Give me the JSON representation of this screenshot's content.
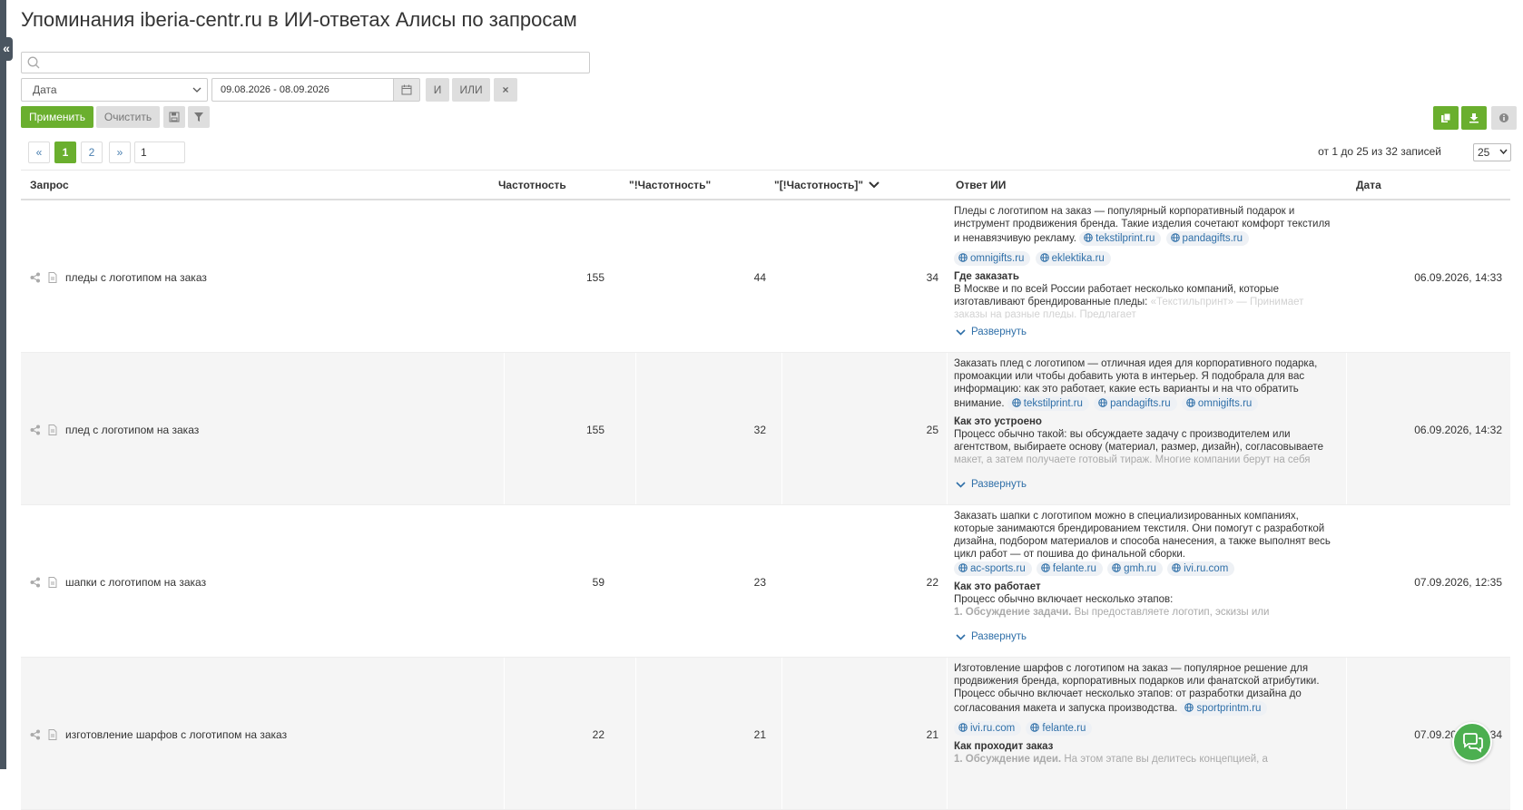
{
  "page": {
    "title": "Упоминания iberia-centr.ru в ИИ-ответах Алисы по запросам"
  },
  "search": {
    "value": "",
    "placeholder": ""
  },
  "filters": {
    "field_label": "Дата",
    "date_range": "09.08.2026 - 08.09.2026",
    "and_label": "И",
    "or_label": "ИЛИ",
    "remove_label": "×"
  },
  "actions": {
    "apply_label": "Применить",
    "clear_label": "Очистить"
  },
  "pagination": {
    "prev_label": "«",
    "pages": [
      "1",
      "2"
    ],
    "next_label": "»",
    "jump_value": "1",
    "records_info": "от 1 до 25 из 32 записей",
    "per_page": "25"
  },
  "table": {
    "columns": [
      "Запрос",
      "Частотность",
      "\"!Частотность\"",
      "\"[!Частотность]\"",
      "Ответ ИИ",
      "Дата"
    ],
    "sorted_column_index": 3,
    "expand_label": "Развернуть",
    "rows": [
      {
        "query": "пледы с логотипом на заказ",
        "freq": "155",
        "freq_exact": "44",
        "freq_exact_order": "34",
        "date": "06.09.2026, 14:33",
        "answer": {
          "intro": "Пледы с логотипом на заказ — популярный корпоративный подарок и инструмент продвижения бренда. Такие изделия сочетают комфорт текстиля и ненавязчивую рекламу.",
          "sources_inline": [
            "tekstilprint.ru",
            "pandagifts.ru"
          ],
          "sources_row": [
            "omnigifts.ru",
            "eklektika.ru"
          ],
          "heading": "Где заказать",
          "body": "В Москве и по всей России работает несколько компаний, которые изготавливают брендированные пледы:",
          "body_faded": "«Текстильпринт» — Принимает заказы на разные пледы. Предлагает"
        }
      },
      {
        "query": "плед с логотипом на заказ",
        "freq": "155",
        "freq_exact": "32",
        "freq_exact_order": "25",
        "date": "06.09.2026, 14:32",
        "answer": {
          "intro": "Заказать плед с логотипом — отличная идея для корпоративного подарка, промоакции или чтобы добавить уюта в интерьер. Я подобрала для вас информацию: как это работает, какие есть варианты и на что обратить внимание.",
          "sources_inline": [
            "tekstilprint.ru",
            "pandagifts.ru",
            "omnigifts.ru"
          ],
          "heading": "Как это устроено",
          "body": "Процесс обычно такой: вы обсуждаете задачу с производителем или агентством, выбираете основу (материал, размер, дизайн), согласовываете",
          "body_faded": "макет, а затем получаете готовый тираж. Многие компании берут на себя"
        }
      },
      {
        "query": "шапки с логотипом на заказ",
        "freq": "59",
        "freq_exact": "23",
        "freq_exact_order": "22",
        "date": "07.09.2026, 12:35",
        "answer": {
          "intro": "Заказать шапки с логотипом можно в специализированных компаниях, которые занимаются брендированием текстиля. Они помогут с разработкой дизайна, подбором материалов и способа нанесения, а также выполнят весь цикл работ — от пошива до финальной сборки.",
          "sources_row": [
            "ac-sports.ru",
            "felante.ru",
            "gmh.ru",
            "ivi.ru.com"
          ],
          "heading": "Как это работает",
          "body": "Процесс обычно включает несколько этапов:",
          "body_faded_bold": "1. Обсуждение задачи.",
          "body_faded": "Вы предоставляете логотип, эскизы или"
        }
      },
      {
        "query": "изготовление шарфов с логотипом на заказ",
        "freq": "22",
        "freq_exact": "21",
        "freq_exact_order": "21",
        "date": "07.09.2026, 12:34",
        "answer": {
          "intro": "Изготовление шарфов с логотипом на заказ — популярное решение для продвижения бренда, корпоративных подарков или фанатской атрибутики. Процесс обычно включает несколько этапов: от разработки дизайна до согласования макета и запуска производства.",
          "sources_inline": [
            "sportprintm.ru"
          ],
          "sources_row": [
            "ivi.ru.com",
            "felante.ru"
          ],
          "heading": "Как проходит заказ",
          "body_faded_bold": "1. Обсуждение идеи.",
          "body_faded": "На этом этапе вы делитесь концепцией, а"
        }
      }
    ]
  },
  "colors": {
    "accent_green": "#6aaf2e",
    "link_blue": "#2f6fa8",
    "chip_bg": "#eef1f5"
  },
  "icons": [
    "collapse-sidebar-icon",
    "search-icon",
    "calendar-icon",
    "save-icon",
    "filter-icon",
    "copy-icon",
    "download-icon",
    "info-icon",
    "share-icon",
    "document-icon",
    "globe-icon",
    "chevron-down-icon",
    "chat-icon"
  ]
}
